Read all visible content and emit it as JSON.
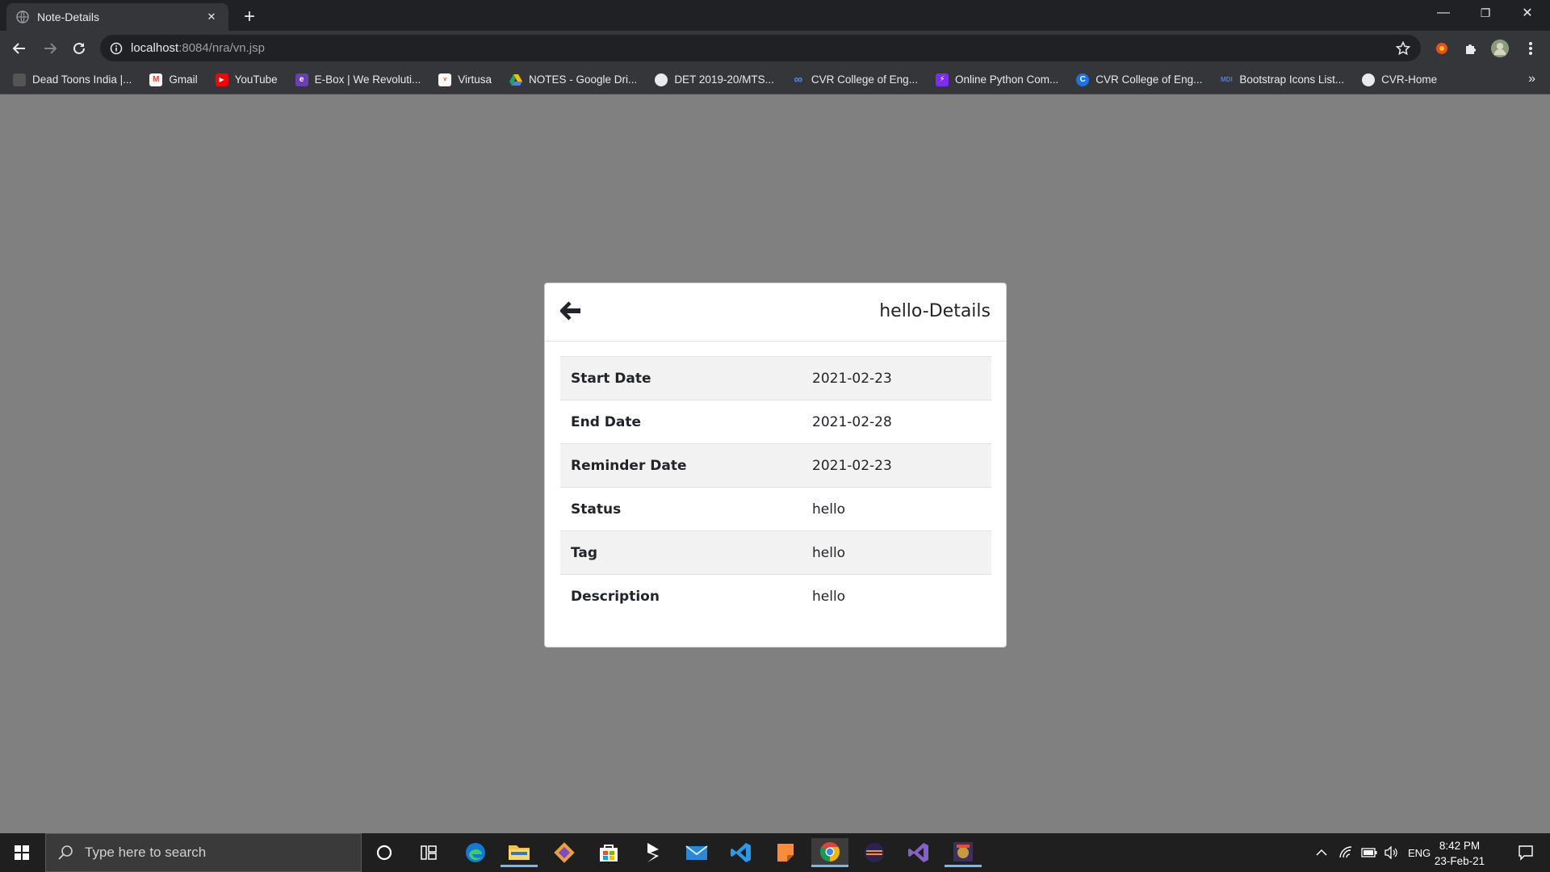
{
  "browser": {
    "tab": {
      "title": "Note-Details",
      "favicon": "globe-icon",
      "close_label": "✕"
    },
    "new_tab_label": "+",
    "window_controls": {
      "minimize": "—",
      "restore": "❐",
      "close": "✕"
    },
    "address": {
      "host": "localhost",
      "path": ":8084/nra/vn.jsp"
    },
    "bookmarks": [
      {
        "label": "Dead Toons India |...",
        "icon": "deadtoons-icon",
        "color": "#444444"
      },
      {
        "label": "Gmail",
        "icon": "gmail-icon",
        "color": "#ffffff"
      },
      {
        "label": "YouTube",
        "icon": "youtube-icon",
        "color": "#ff0000"
      },
      {
        "label": "E-Box | We Revoluti...",
        "icon": "ebox-icon",
        "color": "#6a3fb5"
      },
      {
        "label": "Virtusa",
        "icon": "virtusa-icon",
        "color": "#ffffff"
      },
      {
        "label": "NOTES - Google Dri...",
        "icon": "google-drive-icon",
        "color": "#1fa463"
      },
      {
        "label": "DET 2019-20/MTS...",
        "icon": "globe-icon",
        "color": "#e8eaed"
      },
      {
        "label": "CVR College of Eng...",
        "icon": "infinity-icon",
        "color": "#4b8ff0"
      },
      {
        "label": "Online Python Com...",
        "icon": "replit-icon",
        "color": "#7b2cf5"
      },
      {
        "label": "CVR College of Eng...",
        "icon": "cvr-c-icon",
        "color": "#1a73e8"
      },
      {
        "label": "Bootstrap Icons List...",
        "icon": "mdi-icon",
        "color": "#2a5bd7"
      },
      {
        "label": "CVR-Home",
        "icon": "globe-icon",
        "color": "#e8eaed"
      }
    ],
    "bookmarks_overflow": "»"
  },
  "card": {
    "title": "hello-Details",
    "back_icon": "back-arrow-icon",
    "rows": [
      {
        "label": "Start Date",
        "value": "2021-02-23"
      },
      {
        "label": "End Date",
        "value": "2021-02-28"
      },
      {
        "label": "Reminder Date",
        "value": "2021-02-23"
      },
      {
        "label": "Status",
        "value": "hello"
      },
      {
        "label": "Tag",
        "value": "hello"
      },
      {
        "label": "Description",
        "value": "hello"
      }
    ]
  },
  "taskbar": {
    "search_placeholder": "Type here to search",
    "apps": [
      "cortana-icon",
      "task-view-icon",
      "edge-icon",
      "file-explorer-icon",
      "git-icon",
      "store-icon",
      "sublime-icon",
      "mail-icon",
      "vscode-icon",
      "sticky-notes-icon",
      "chrome-icon",
      "eclipse-icon",
      "visual-studio-icon",
      "game-icon"
    ],
    "language": "ENG",
    "time": "8:42 PM",
    "date": "23-Feb-21"
  },
  "colors": {
    "page_background": "#808080",
    "chrome_dark": "#202124",
    "chrome_toolbar": "#35363a",
    "taskbar": "#1f1f1f",
    "accent": "#76b9ed"
  }
}
